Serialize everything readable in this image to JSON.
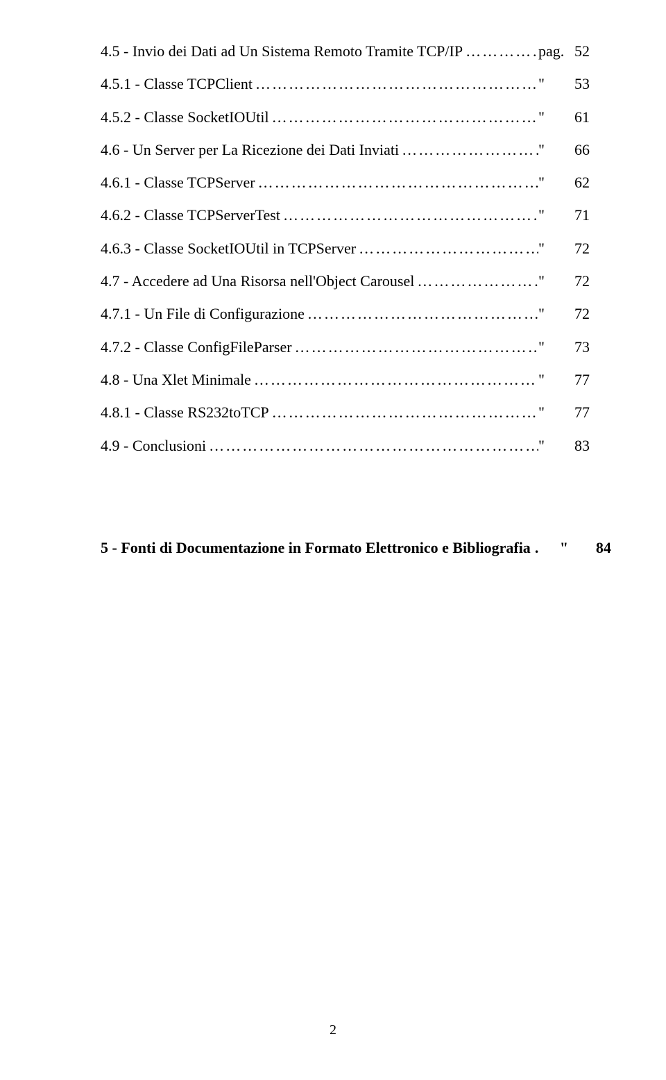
{
  "dots": "…………………………………………………………………………………………………………………………",
  "toc": [
    {
      "label": "4.5 - Invio dei Dati ad Un Sistema Remoto Tramite TCP/IP",
      "sep": "… ",
      "prefix": "pag.",
      "page": "52"
    },
    {
      "label": "4.5.1 - Classe TCPClient",
      "sep": ". ",
      "prefix": "\"",
      "page": "53"
    },
    {
      "label": "4.5.2 - Classe SocketIOUtil",
      "sep": ". ",
      "prefix": "\"",
      "page": "61"
    },
    {
      "label": "4.6 - Un Server per La Ricezione dei Dati Inviati",
      "sep": "... ",
      "prefix": "\"",
      "page": "66"
    },
    {
      "label": "4.6.1 - Classe TCPServer",
      "sep": ". ",
      "prefix": "\"",
      "page": "62"
    },
    {
      "label": "4.6.2 - Classe TCPServerTest",
      "sep": ".. ",
      "prefix": "\"",
      "page": "71"
    },
    {
      "label": "4.6.3 - Classe SocketIOUtil in TCPServer",
      "sep": ".. ",
      "prefix": "\"",
      "page": "72"
    },
    {
      "label": "4.7 - Accedere ad Una Risorsa nell'Object Carousel",
      "sep": ".. ",
      "prefix": "\"",
      "page": "72"
    },
    {
      "label": "4.7.1 - Un File di Configurazione",
      "sep": " ",
      "prefix": "\"",
      "page": "72"
    },
    {
      "label": "4.7.2 - Classe ConfigFileParser",
      "sep": "... ",
      "prefix": "\"",
      "page": "73"
    },
    {
      "label": "4.8 - Una Xlet Minimale",
      "sep": ".. ",
      "prefix": "\"",
      "page": "77"
    },
    {
      "label": "4.8.1 - Classe RS232toTCP",
      "sep": " ",
      "prefix": "\"",
      "page": "77"
    },
    {
      "label": "4.9 - Conclusioni",
      "sep": ".. ",
      "prefix": "\"",
      "page": "83"
    }
  ],
  "chapter5": {
    "label": "5 - Fonti di Documentazione in Formato Elettronico e Bibliografia",
    "sep": ". ",
    "prefix": "\"",
    "page": "84"
  },
  "footer": {
    "pageNumber": "2"
  }
}
